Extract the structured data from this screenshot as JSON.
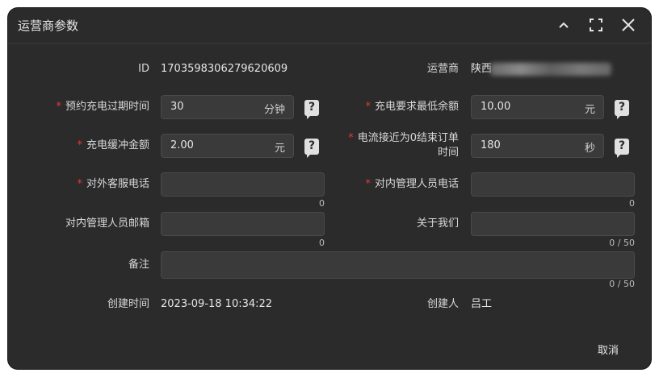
{
  "dialog": {
    "title": "运营商参数",
    "icons": {
      "collapse": "chevron-up-icon",
      "fullscreen": "fullscreen-icon",
      "close": "close-icon"
    }
  },
  "form": {
    "id": {
      "label": "ID",
      "value": "1703598306279620609"
    },
    "operator": {
      "label": "运营商",
      "value": "陕西"
    },
    "reserve_expire": {
      "label": "预约充电过期时间",
      "required": "*",
      "value": "30",
      "unit": "分钟"
    },
    "min_balance": {
      "label": "充电要求最低余额",
      "required": "*",
      "value": "10.00",
      "unit": "元"
    },
    "buffer_amount": {
      "label": "充电缓冲金额",
      "required": "*",
      "value": "2.00",
      "unit": "元"
    },
    "current_end_time": {
      "label_line1": "电流接近为0结束订单",
      "label_line2": "时间",
      "required": "*",
      "value": "180",
      "unit": "秒"
    },
    "external_phone": {
      "label": "对外客服电话",
      "required": "*",
      "value": "",
      "count": "0"
    },
    "internal_phone": {
      "label": "对内管理人员电话",
      "required": "*",
      "value": "",
      "count": "0"
    },
    "internal_email": {
      "label": "对内管理人员邮箱",
      "value": "",
      "count": "0"
    },
    "about_us": {
      "label": "关于我们",
      "value": "",
      "count": "0 / 50"
    },
    "remark": {
      "label": "备注",
      "value": "",
      "count": "0 / 50"
    },
    "created_time": {
      "label": "创建时间",
      "value": "2023-09-18 10:34:22"
    },
    "creator": {
      "label": "创建人",
      "value": "吕工"
    }
  },
  "help_icon_text": "?",
  "footer": {
    "cancel": "取消"
  }
}
